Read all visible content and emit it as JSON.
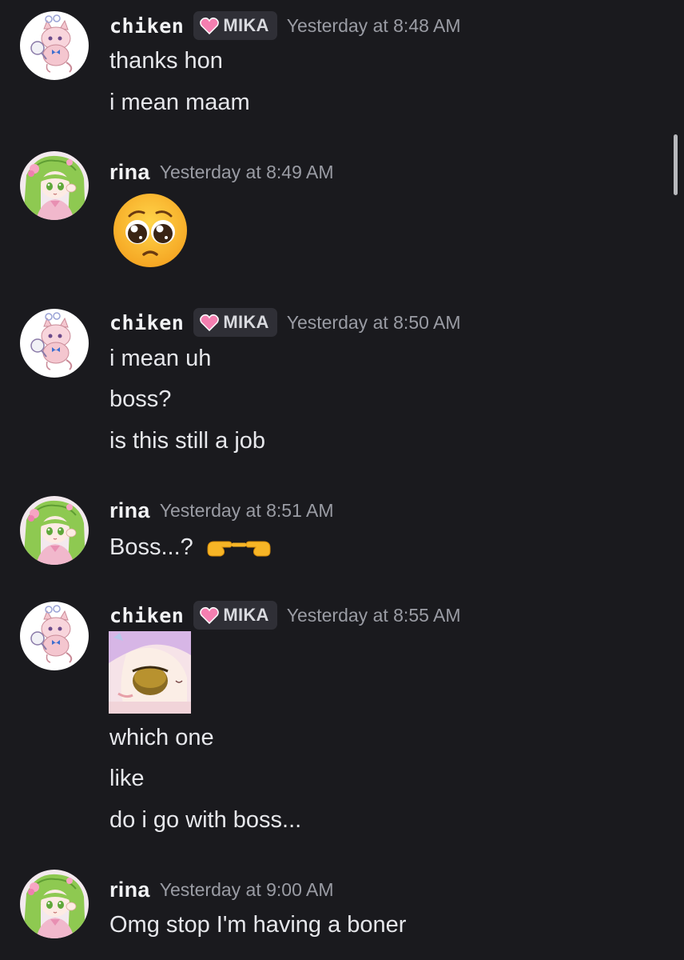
{
  "messages": [
    {
      "author": "chiken",
      "tag": "MIKA",
      "timestamp": "Yesterday at 8:48 AM",
      "lines": [
        "thanks hon",
        "i mean maam"
      ]
    },
    {
      "author": "rina",
      "timestamp": "Yesterday at 8:49 AM",
      "emoji": "pleading-face-icon"
    },
    {
      "author": "chiken",
      "tag": "MIKA",
      "timestamp": "Yesterday at 8:50 AM",
      "lines": [
        "i mean uh",
        "boss?",
        "is this still a job"
      ]
    },
    {
      "author": "rina",
      "timestamp": "Yesterday at 8:51 AM",
      "lines": [
        "Boss...?"
      ],
      "trailing_emoji": "pointing-fingers-icon"
    },
    {
      "author": "chiken",
      "tag": "MIKA",
      "timestamp": "Yesterday at 8:55 AM",
      "sticker": "anime-peek-sticker",
      "lines": [
        "which one",
        "like",
        "do i go with boss..."
      ]
    },
    {
      "author": "rina",
      "timestamp": "Yesterday at 9:00 AM",
      "lines": [
        "Omg stop I'm having a boner"
      ]
    }
  ],
  "colors": {
    "background": "#1a1a1e",
    "username": "#f2f3f5",
    "timestamp": "#9a9ca4",
    "message_text": "#e6e7eb",
    "tag_background": "#2f2f36",
    "tag_heart": "#f47fb0"
  }
}
